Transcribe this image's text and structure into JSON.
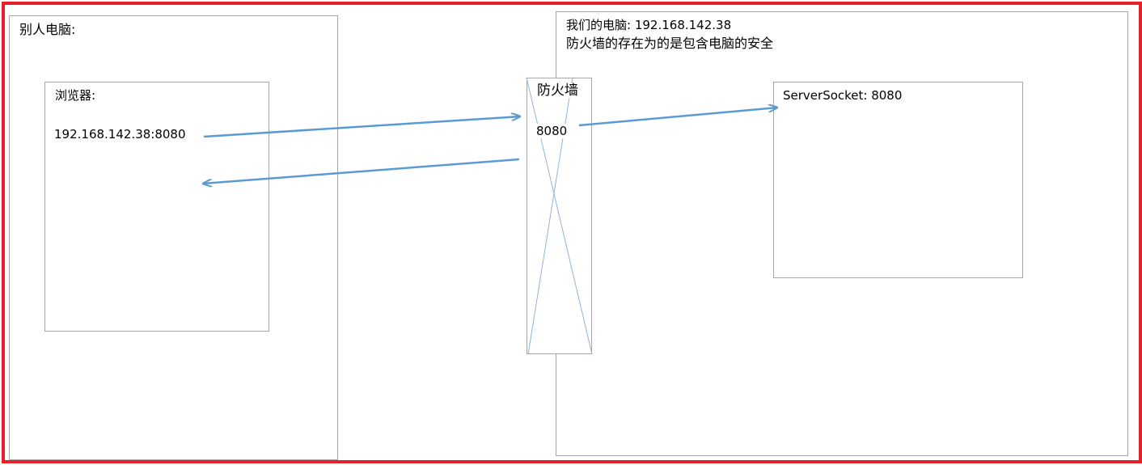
{
  "other_computer": {
    "title": "别人电脑:",
    "browser": {
      "title": "浏览器:",
      "address": "192.168.142.38:8080"
    }
  },
  "firewall": {
    "title": "防火墙",
    "port": "8080"
  },
  "our_computer": {
    "title_prefix": "我们的电脑:",
    "ip": "192.168.142.38",
    "note": "防火墙的存在为的是包含电脑的安全",
    "server": {
      "label": "ServerSocket:  8080"
    }
  },
  "colors": {
    "frame": "#e8202a",
    "box_border": "#a6a6a6",
    "arrow": "#5b9bd5"
  }
}
